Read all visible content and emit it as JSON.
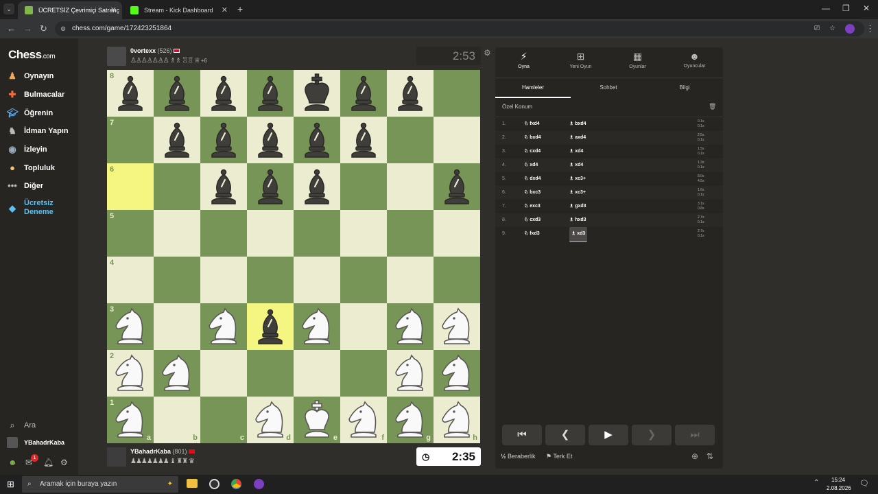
{
  "browser": {
    "tabs": [
      {
        "title": "ÜCRETSİZ Çevrimiçi Satranç"
      },
      {
        "title": "Stream - Kick Dashboard"
      }
    ],
    "url": "chess.com/game/172423251864"
  },
  "sidebar": {
    "logo": "Chess",
    "logo_suffix": ".com",
    "items": [
      {
        "label": "Oynayın",
        "icon": "pawn-icon"
      },
      {
        "label": "Bulmacalar",
        "icon": "puzzle-icon"
      },
      {
        "label": "Öğrenin",
        "icon": "learn-icon"
      },
      {
        "label": "İdman Yapın",
        "icon": "train-icon"
      },
      {
        "label": "İzleyin",
        "icon": "watch-icon"
      },
      {
        "label": "Topluluk",
        "icon": "community-icon"
      },
      {
        "label": "Diğer",
        "icon": "more-icon"
      },
      {
        "label": "Ücretsiz Deneme",
        "icon": "diamond-icon"
      }
    ],
    "search": "Ara",
    "user": "YBahadrKaba",
    "notif_count": "1"
  },
  "top_player": {
    "name": "0vortexx",
    "rating": "(526)",
    "material": "+6",
    "clock": "2:53"
  },
  "bottom_player": {
    "name": "YBahadrKaba",
    "rating": "(801)",
    "clock": "2:35"
  },
  "board": {
    "files": [
      "a",
      "b",
      "c",
      "d",
      "e",
      "f",
      "g",
      "h"
    ],
    "ranks": [
      "8",
      "7",
      "6",
      "5",
      "4",
      "3",
      "2",
      "1"
    ]
  },
  "panel": {
    "top_tabs": [
      {
        "label": "Oyna",
        "icon": "bolt-icon"
      },
      {
        "label": "Yeni Oyun",
        "icon": "plus-icon"
      },
      {
        "label": "Oyunlar",
        "icon": "grid-icon"
      },
      {
        "label": "Oyuncular",
        "icon": "players-icon"
      }
    ],
    "sub_tabs": [
      "Hamleler",
      "Sohbet",
      "Bilgi"
    ],
    "position_label": "Özel Konum",
    "moves": [
      {
        "n": "1.",
        "w": "fxd4",
        "b": "bxd4",
        "tw": "0.1s",
        "tb": "0.1s"
      },
      {
        "n": "2.",
        "w": "bxd4",
        "b": "axd4",
        "tw": "2.5s",
        "tb": "0.1s"
      },
      {
        "n": "3.",
        "w": "cxd4",
        "b": "xd4",
        "tw": "1.5s",
        "tb": "0.1s"
      },
      {
        "n": "4.",
        "w": "xd4",
        "b": "xd4",
        "tw": "1.3s",
        "tb": "0.1s"
      },
      {
        "n": "5.",
        "w": "dxd4",
        "b": "xc3+",
        "tw": "8.0s",
        "tb": "4.5s"
      },
      {
        "n": "6.",
        "w": "bxc3",
        "b": "xc3+",
        "tw": "1.6s",
        "tb": "0.1s"
      },
      {
        "n": "7.",
        "w": "exc3",
        "b": "gxd3",
        "tw": "3.1s",
        "tb": "0.8s"
      },
      {
        "n": "8.",
        "w": "cxd3",
        "b": "hxd3",
        "tw": "2.7s",
        "tb": "0.1s"
      },
      {
        "n": "9.",
        "w": "fxd3",
        "b": "xd3",
        "tw": "2.7s",
        "tb": "0.1s"
      }
    ],
    "draw_label": "Beraberlik",
    "resign_label": "Terk Et"
  },
  "taskbar": {
    "search_placeholder": "Aramak için buraya yazın",
    "time": "15:24",
    "date": "2.08.2026"
  }
}
